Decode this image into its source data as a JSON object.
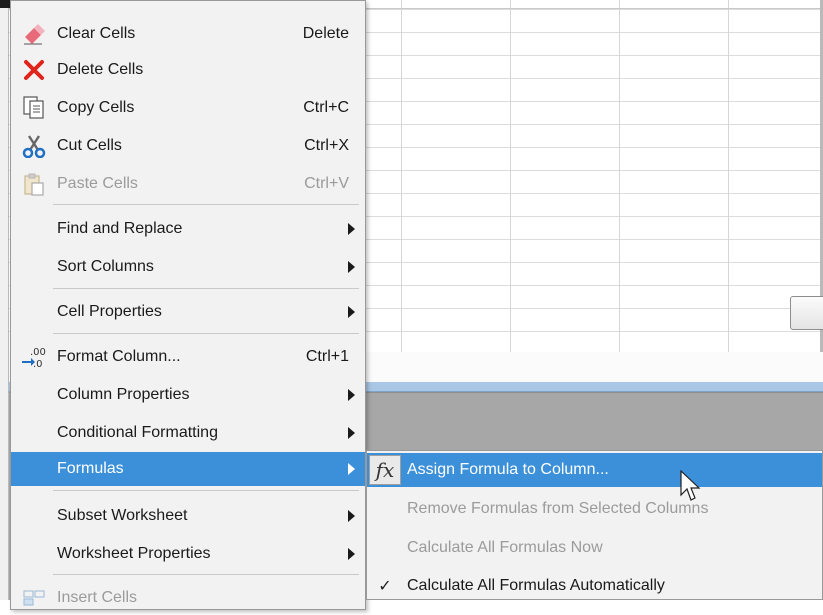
{
  "context_menu": {
    "items": [
      {
        "label": "Clear Cells",
        "shortcut": "Delete",
        "icon": "eraser-icon"
      },
      {
        "label": "Delete Cells",
        "shortcut": "",
        "icon": "red-x-icon"
      },
      {
        "label": "Copy Cells",
        "shortcut": "Ctrl+C",
        "icon": "copy-icon"
      },
      {
        "label": "Cut Cells",
        "shortcut": "Ctrl+X",
        "icon": "scissors-icon"
      },
      {
        "label": "Paste Cells",
        "shortcut": "Ctrl+V",
        "icon": "paste-icon",
        "disabled": true
      },
      {
        "label": "Find and Replace",
        "submenu": true
      },
      {
        "label": "Sort Columns",
        "submenu": true
      },
      {
        "label": "Cell Properties",
        "submenu": true
      },
      {
        "label": "Format Column...",
        "shortcut": "Ctrl+1",
        "icon": "decimal-format-icon"
      },
      {
        "label": "Column Properties",
        "submenu": true
      },
      {
        "label": "Conditional Formatting",
        "submenu": true
      },
      {
        "label": "Formulas",
        "submenu": true,
        "highlighted": true
      },
      {
        "label": "Subset Worksheet",
        "submenu": true
      },
      {
        "label": "Worksheet Properties",
        "submenu": true
      },
      {
        "label": "Insert Cells",
        "icon": "insert-cells-icon",
        "disabled": true
      }
    ]
  },
  "formulas_submenu": {
    "items": [
      {
        "label": "Assign Formula to Column...",
        "icon": "fx-icon",
        "highlighted": true
      },
      {
        "label": "Remove Formulas from Selected Columns",
        "disabled": true
      },
      {
        "label": "Calculate All Formulas Now",
        "disabled": true
      },
      {
        "label": "Calculate All Formulas Automatically",
        "checked": true
      }
    ],
    "fx_glyph": "fx",
    "check_glyph": "✓"
  },
  "colors": {
    "highlight": "#3b90d9",
    "menu_background": "#f2f2f2",
    "disabled_text": "#9b9b9b",
    "panel_gray": "#a7a7a7"
  }
}
